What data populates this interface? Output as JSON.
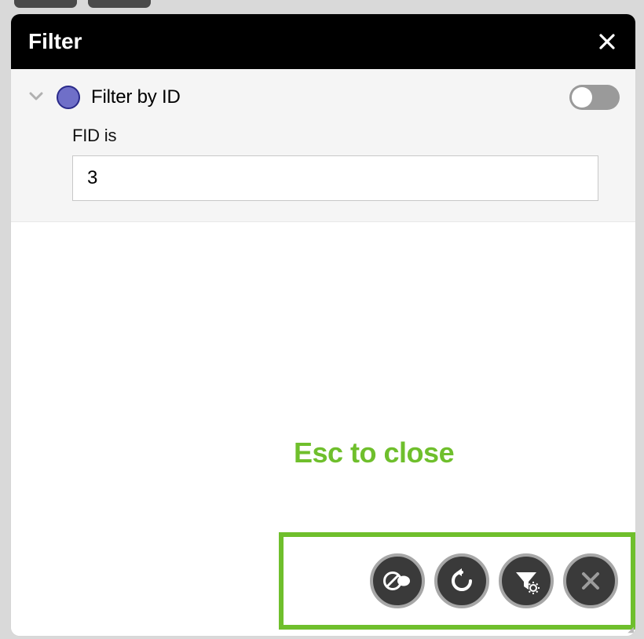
{
  "modal": {
    "title": "Filter",
    "close_icon": "close"
  },
  "filter": {
    "title": "Filter by ID",
    "enabled": false,
    "field": {
      "label": "FID is",
      "value": "3"
    }
  },
  "hint": {
    "text": "Esc to close"
  },
  "actions": [
    {
      "name": "toggle-off",
      "icon": "block-toggle"
    },
    {
      "name": "reset",
      "icon": "undo"
    },
    {
      "name": "filter-settings",
      "icon": "funnel-gear"
    },
    {
      "name": "close",
      "icon": "x"
    }
  ],
  "colors": {
    "accent_green": "#6fbf2c",
    "dot_fill": "#6f6fc8",
    "dot_border": "#2a2a8a",
    "toggle_off": "#9a9a9a",
    "button_bg": "#3a3a3a",
    "button_ring": "#a7a7a7"
  }
}
